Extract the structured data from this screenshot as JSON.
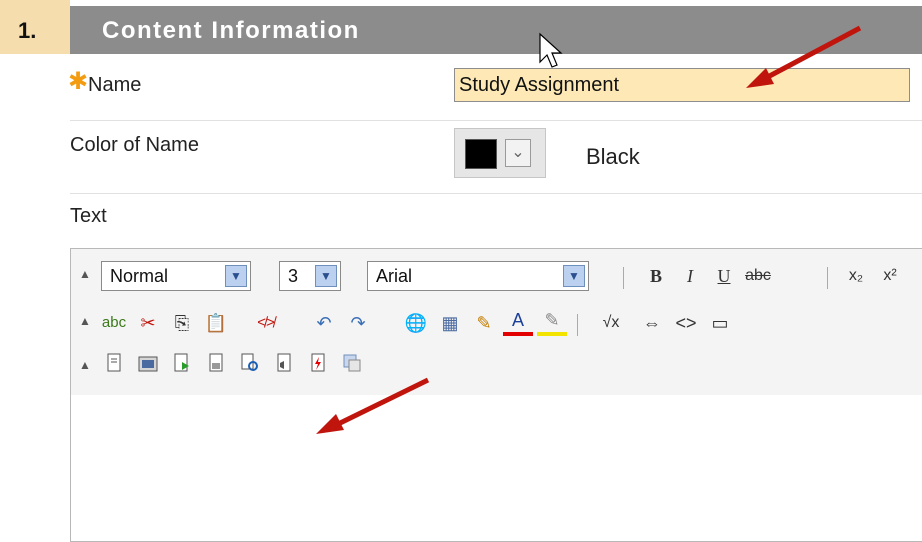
{
  "header": {
    "step_number": "1.",
    "title": "Content Information"
  },
  "name_field": {
    "label": "Name",
    "value": "Study Assignment"
  },
  "color_field": {
    "label": "Color of Name",
    "selected_color_name": "Black",
    "swatch_color": "#000000"
  },
  "text_field": {
    "label": "Text"
  },
  "editor": {
    "format_select": "Normal",
    "size_select": "3",
    "font_select": "Arial",
    "buttons": {
      "bold": "B",
      "italic": "I",
      "underline": "U",
      "strike": "abc",
      "subscript": "x₂",
      "superscript": "x²",
      "spell": "abc",
      "cut": "✂",
      "copy": "⎘",
      "paste": "📋",
      "link_off": "≮≯",
      "undo": "↶",
      "redo": "↷",
      "globe": "🌐",
      "table": "▦",
      "pencil": "✎",
      "font_color": "A",
      "highlight": "✎",
      "sqrt": "√x",
      "arrows": "⇔",
      "code": "<>",
      "window": "▭"
    }
  },
  "colors": {
    "accent": "#f39c12",
    "header_bar": "#8c8c8c",
    "step_box": "#f6ddae",
    "input_bg": "#fde8b6",
    "arrow": "#c0150d"
  }
}
